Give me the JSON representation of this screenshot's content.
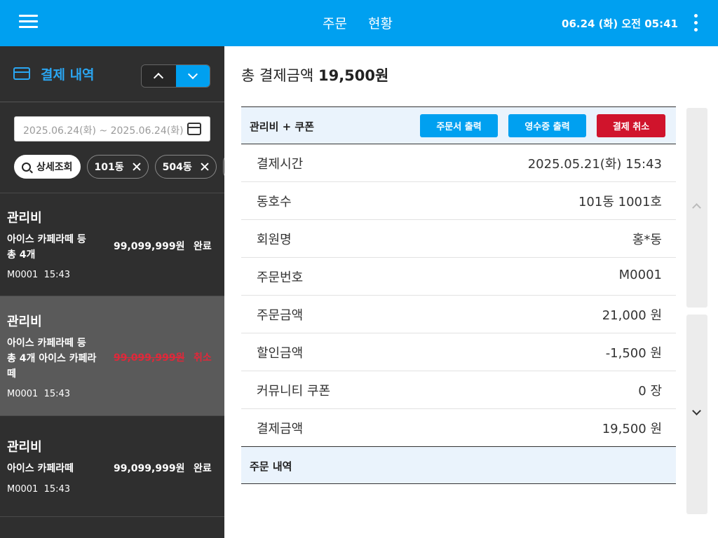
{
  "topbar": {
    "nav": [
      "주문",
      "현황"
    ],
    "datetime": "06.24 (화) 오전 05:41",
    "accent": "#00a0f0"
  },
  "sidebar": {
    "title": "결제 내역",
    "date_range": "2025.06.24(화) ~ 2025.06.24(화)",
    "chips": {
      "search": "상세조회",
      "filters": [
        "101동",
        "504동"
      ]
    },
    "orders": [
      {
        "category": "관리비",
        "item": "아이스 카페라떼 등 총 4개",
        "amount": "99,099,999원",
        "status": "완료",
        "order_no": "M0001",
        "time": "15:43"
      },
      {
        "category": "관리비",
        "item": "아이스 카페라떼 등 총 4개 아이스 카페라떼",
        "amount": "99,099,999원",
        "status": "취소",
        "order_no": "M0001",
        "time": "15:43"
      },
      {
        "category": "관리비",
        "item": "아이스 카페라떼",
        "amount": "99,099,999원",
        "status": "완료",
        "order_no": "M0001",
        "time": "15:43"
      }
    ]
  },
  "main": {
    "total_label": "총 결제금액",
    "total_value": "19,500원",
    "panel_title": "관리비 + 쿠폰",
    "buttons": {
      "print_order": "주문서 출력",
      "print_receipt": "영수증 출력",
      "cancel": "결제 취소"
    },
    "details": [
      {
        "key": "결제시간",
        "value": "2025.05.21(화) 15:43"
      },
      {
        "key": "동호수",
        "value": "101동 1001호"
      },
      {
        "key": "회원명",
        "value": "홍*동"
      },
      {
        "key": "주문번호",
        "value": "M0001"
      },
      {
        "key": "주문금액",
        "value": "21,000 원"
      },
      {
        "key": "할인금액",
        "value": "-1,500 원"
      },
      {
        "key": "커뮤니티 쿠폰",
        "value": "0 장"
      },
      {
        "key": "결제금액",
        "value": "19,500 원"
      }
    ],
    "order_section": "주문 내역"
  },
  "icons": [
    "menu-icon",
    "kebab-menu-icon",
    "card-icon",
    "chevron-up-icon",
    "chevron-down-icon",
    "calendar-icon",
    "search-icon",
    "close-icon"
  ]
}
